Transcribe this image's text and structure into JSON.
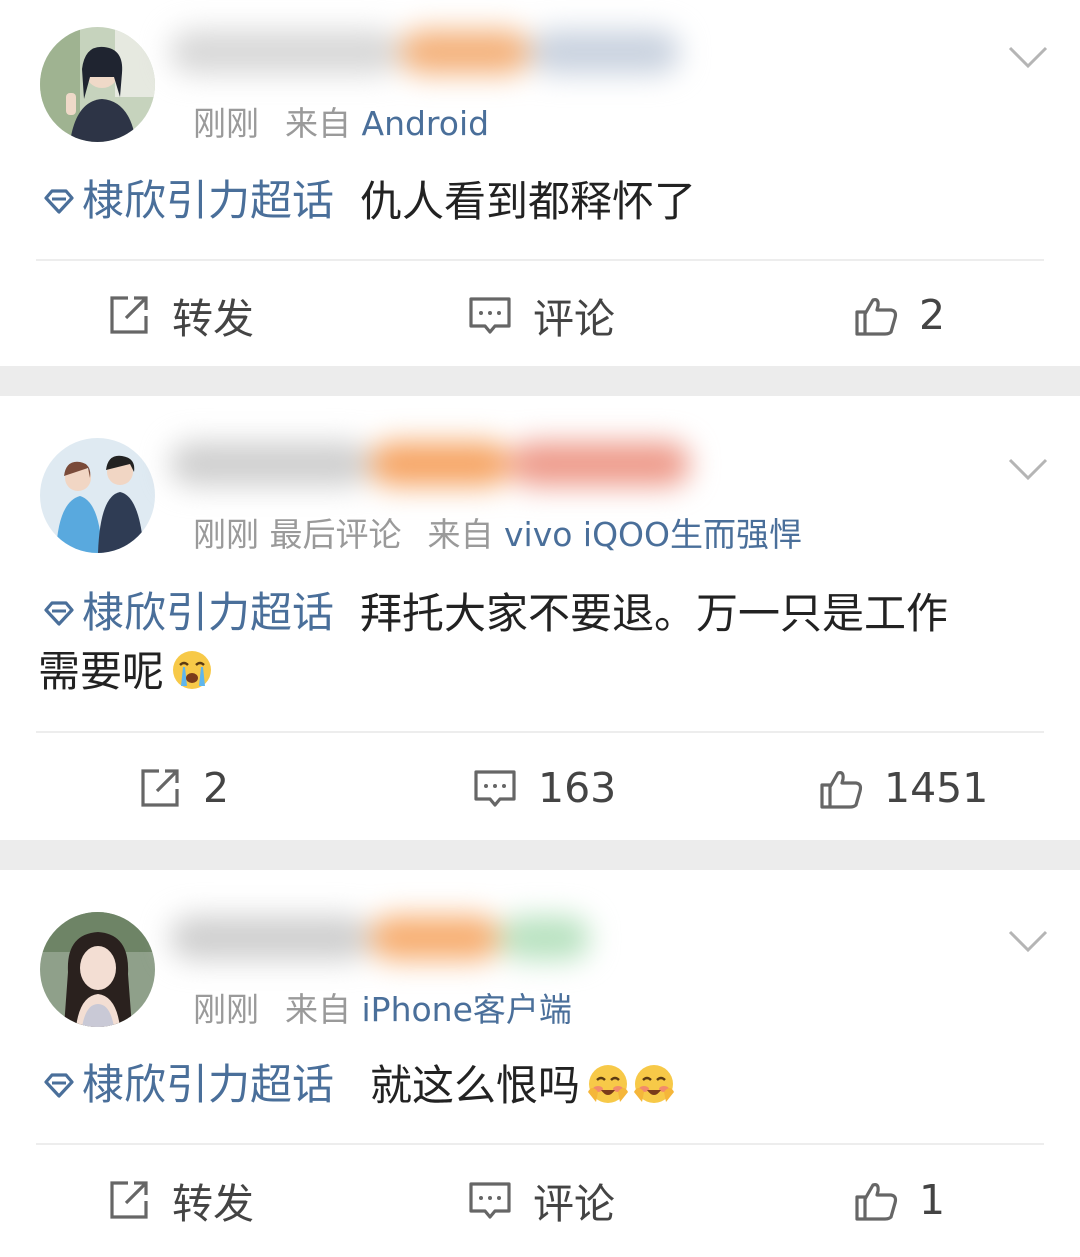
{
  "posts": [
    {
      "time": "刚刚",
      "extra": "",
      "from_label": "来自",
      "source": "Android",
      "topic": "棣欣引力超话",
      "text": "仇人看到都释怀了",
      "text2": "",
      "emojis": [],
      "repost": "转发",
      "comment": "评论",
      "like": "2",
      "avatar_colors": [
        "#b9c7b0",
        "#e8eadf",
        "#2a2f3a"
      ],
      "blur_colors": [
        "#d8d8d8",
        "#f4b17a",
        "#c9d2df"
      ]
    },
    {
      "time": "刚刚",
      "extra": "最后评论",
      "from_label": "来自",
      "source": "vivo iQOO生而强悍",
      "topic": "棣欣引力超话",
      "text": "拜托大家不要退。万一只是工作",
      "text2": "需要呢",
      "emojis": [
        "crying-face-icon"
      ],
      "repost": "2",
      "comment": "163",
      "like": "1451",
      "avatar_colors": [
        "#d9e8f2",
        "#4f9fd6",
        "#2c3e58"
      ],
      "blur_colors": [
        "#cfcfcf",
        "#f6a463",
        "#ee9a8a"
      ]
    },
    {
      "time": "刚刚",
      "extra": "",
      "from_label": "来自",
      "source": "iPhone客户端",
      "topic": "棣欣引力超话",
      "text": "就这么恨吗",
      "text2": "",
      "emojis": [
        "blushing-face-icon",
        "blushing-face-icon"
      ],
      "repost": "转发",
      "comment": "评论",
      "like": "1",
      "avatar_colors": [
        "#8c9c82",
        "#f0dcd0",
        "#2b2320"
      ],
      "blur_colors": [
        "#cfcfcf",
        "#f7ad6f",
        "#b8e2c0"
      ]
    }
  ],
  "colors": {
    "link": "#4a6f9a",
    "meta": "#9a9a9a",
    "separator": "#ececec"
  }
}
